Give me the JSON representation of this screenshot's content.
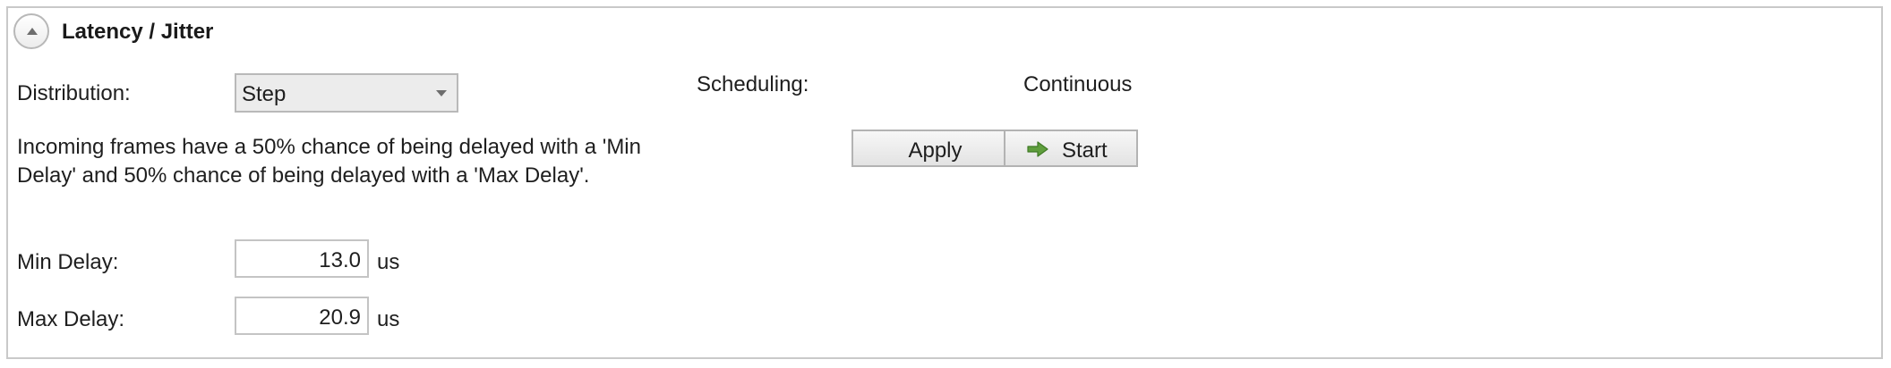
{
  "panel": {
    "title": "Latency / Jitter",
    "collapse_icon": "chevron-up-icon"
  },
  "distribution": {
    "label": "Distribution:",
    "selected": "Step",
    "caret_icon": "chevron-down-icon"
  },
  "description": "Incoming frames have a 50% chance of being delayed with a 'Min Delay' and 50% chance of being delayed with a 'Max Delay'.",
  "scheduling": {
    "label": "Scheduling:",
    "value": "Continuous"
  },
  "buttons": {
    "apply": "Apply",
    "start": "Start",
    "start_icon": "arrow-right-icon",
    "start_icon_color": "#5f9e3d"
  },
  "min_delay": {
    "label": "Min Delay:",
    "value": "13.0",
    "unit": "us"
  },
  "max_delay": {
    "label": "Max Delay:",
    "value": "20.9",
    "unit": "us"
  }
}
